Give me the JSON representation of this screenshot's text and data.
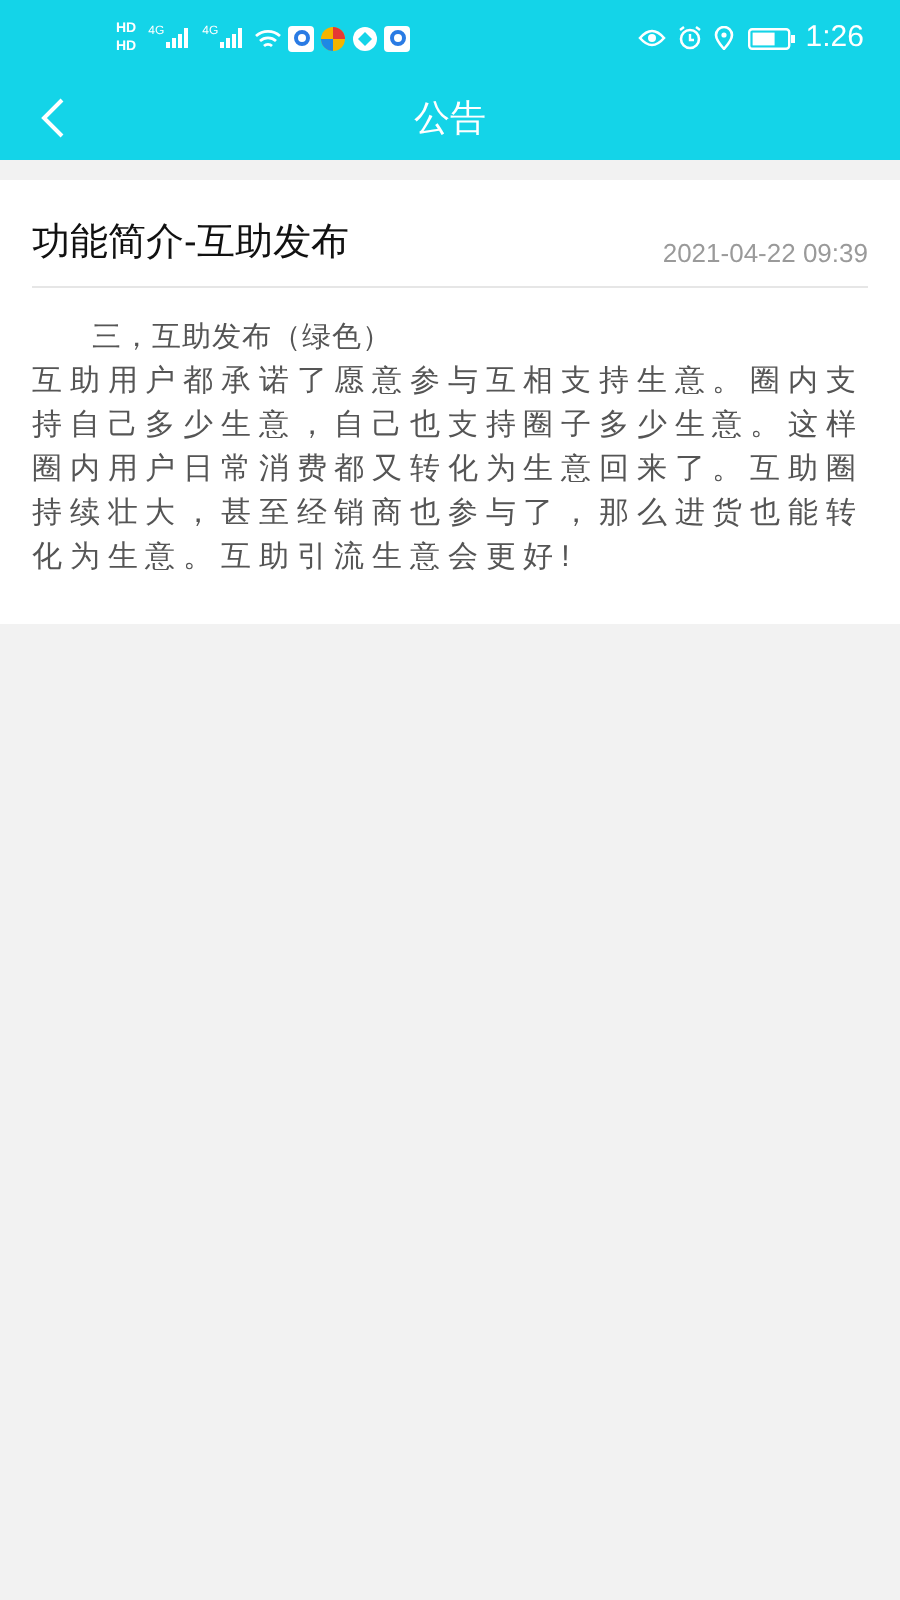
{
  "status_bar": {
    "sim_labels": [
      "HD",
      "HD"
    ],
    "network_labels": [
      "4G",
      "4G"
    ],
    "time": "1:26"
  },
  "nav_bar": {
    "title": "公告"
  },
  "article": {
    "title": "功能简介-互助发布",
    "date": "2021-04-22 09:39",
    "heading": "三，互助发布（绿色）",
    "body": "互助用户都承诺了愿意参与互相支持生意。圈内支持自己多少生意，自己也支持圈子多少生意。这样圈内用户日常消费都又转化为生意回来了。互助圈持续壮大，甚至经销商也参与了，那么进货也能转化为生意。互助引流生意会更好!"
  }
}
